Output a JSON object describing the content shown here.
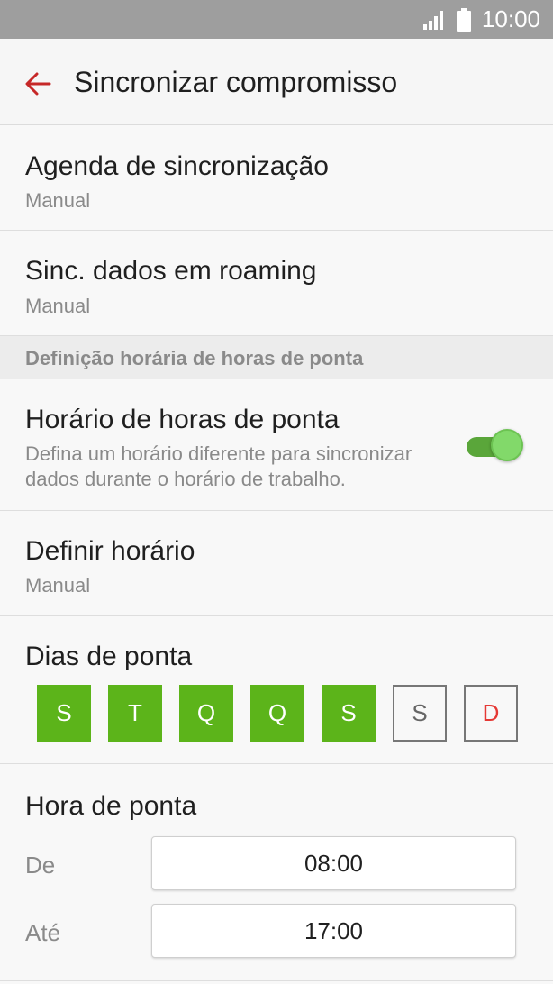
{
  "status_bar": {
    "time": "10:00",
    "icons": [
      "signal-icon",
      "battery-icon"
    ]
  },
  "app_bar": {
    "title": "Sincronizar compromisso",
    "back_icon": "back-arrow-icon",
    "accent": "#c62828"
  },
  "settings": {
    "sync_schedule": {
      "title": "Agenda de sincronização",
      "value": "Manual"
    },
    "roaming_sync": {
      "title": "Sinc. dados em roaming",
      "value": "Manual"
    }
  },
  "peak_section": {
    "header": "Definição horária de horas de ponta",
    "peak_schedule": {
      "title": "Horário de horas de ponta",
      "description_line1": "Defina um horário diferente para sincronizar",
      "description_line2": "dados durante o horário de trabalho.",
      "enabled": true
    },
    "set_schedule": {
      "title": "Definir horário",
      "value": "Manual"
    },
    "peak_days": {
      "title": "Dias de ponta",
      "days": [
        {
          "label": "S",
          "selected": true
        },
        {
          "label": "T",
          "selected": true
        },
        {
          "label": "Q",
          "selected": true
        },
        {
          "label": "Q",
          "selected": true
        },
        {
          "label": "S",
          "selected": true
        },
        {
          "label": "S",
          "selected": false
        },
        {
          "label": "D",
          "selected": false
        }
      ]
    },
    "peak_hours": {
      "title": "Hora de ponta",
      "from_label": "De",
      "from_value": "08:00",
      "to_label": "Até",
      "to_value": "17:00"
    }
  },
  "colors": {
    "toggle_on": "#5aa63a",
    "day_selected": "#5cb41a",
    "sunday": "#e53935"
  }
}
